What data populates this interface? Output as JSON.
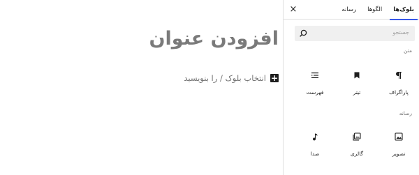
{
  "editor": {
    "title": "افزودن عنوان",
    "appender_placeholder": "انتخاب بلوک / را بنویسید",
    "appender_symbol": "+"
  },
  "inserter": {
    "tabs": [
      {
        "label": "بلوک‌ها",
        "active": true
      },
      {
        "label": "الگوها",
        "active": false
      },
      {
        "label": "رسانه",
        "active": false
      }
    ],
    "close_symbol": "×",
    "search": {
      "placeholder": "جستجو"
    },
    "categories": [
      {
        "title": "متن",
        "blocks": [
          {
            "label": "پاراگراف",
            "icon": "paragraph-icon"
          },
          {
            "label": "تیتر",
            "icon": "bookmark-icon"
          },
          {
            "label": "فهرست",
            "icon": "list-icon"
          }
        ]
      },
      {
        "title": "رسانه",
        "blocks": [
          {
            "label": "تصویر",
            "icon": "image-icon"
          },
          {
            "label": "گالری",
            "icon": "gallery-icon"
          },
          {
            "label": "صدا",
            "icon": "audio-icon"
          }
        ]
      }
    ]
  },
  "colors": {
    "accent": "#3858e9",
    "text": "#1e1e1e",
    "muted": "#757575"
  }
}
